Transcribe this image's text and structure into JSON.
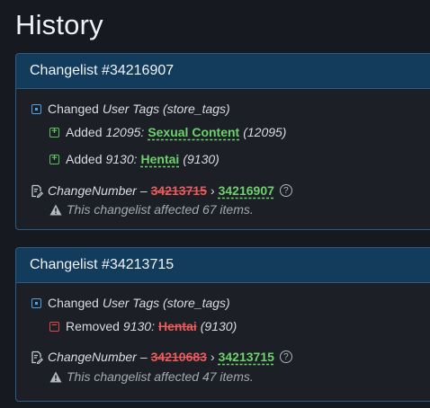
{
  "page": {
    "title": "History"
  },
  "changelists": [
    {
      "header": "Changelist #34216907",
      "change": {
        "verb": "Changed",
        "field": "User Tags (store_tags)"
      },
      "items": [
        {
          "action": "Added",
          "id": "12095",
          "name": "Sexual Content",
          "paren": "(12095)"
        },
        {
          "action": "Added",
          "id": "9130",
          "name": "Hentai",
          "paren": "(9130)"
        }
      ],
      "change_number": {
        "label": "ChangeNumber",
        "dash": "–",
        "old": "34213715",
        "arrow": "›",
        "new": "34216907"
      },
      "affected": "This changelist affected 67 items."
    },
    {
      "header": "Changelist #34213715",
      "change": {
        "verb": "Changed",
        "field": "User Tags (store_tags)"
      },
      "items": [
        {
          "action": "Removed",
          "id": "9130",
          "name": "Hentai",
          "paren": "(9130)"
        }
      ],
      "change_number": {
        "label": "ChangeNumber",
        "dash": "–",
        "old": "34210683",
        "arrow": "›",
        "new": "34213715"
      },
      "affected": "This changelist affected 47 items."
    }
  ],
  "colors": {
    "accent": "#123b5c",
    "added": "#6cd36c",
    "removed": "#ea5b5b",
    "info": "#4ea3e6"
  },
  "icons": {
    "changed": "square-dot-icon",
    "added": "plus-box-icon",
    "removed": "minus-box-icon",
    "changelist": "document-edit-icon",
    "help": "help-circle-icon",
    "warning": "warning-triangle-icon"
  }
}
